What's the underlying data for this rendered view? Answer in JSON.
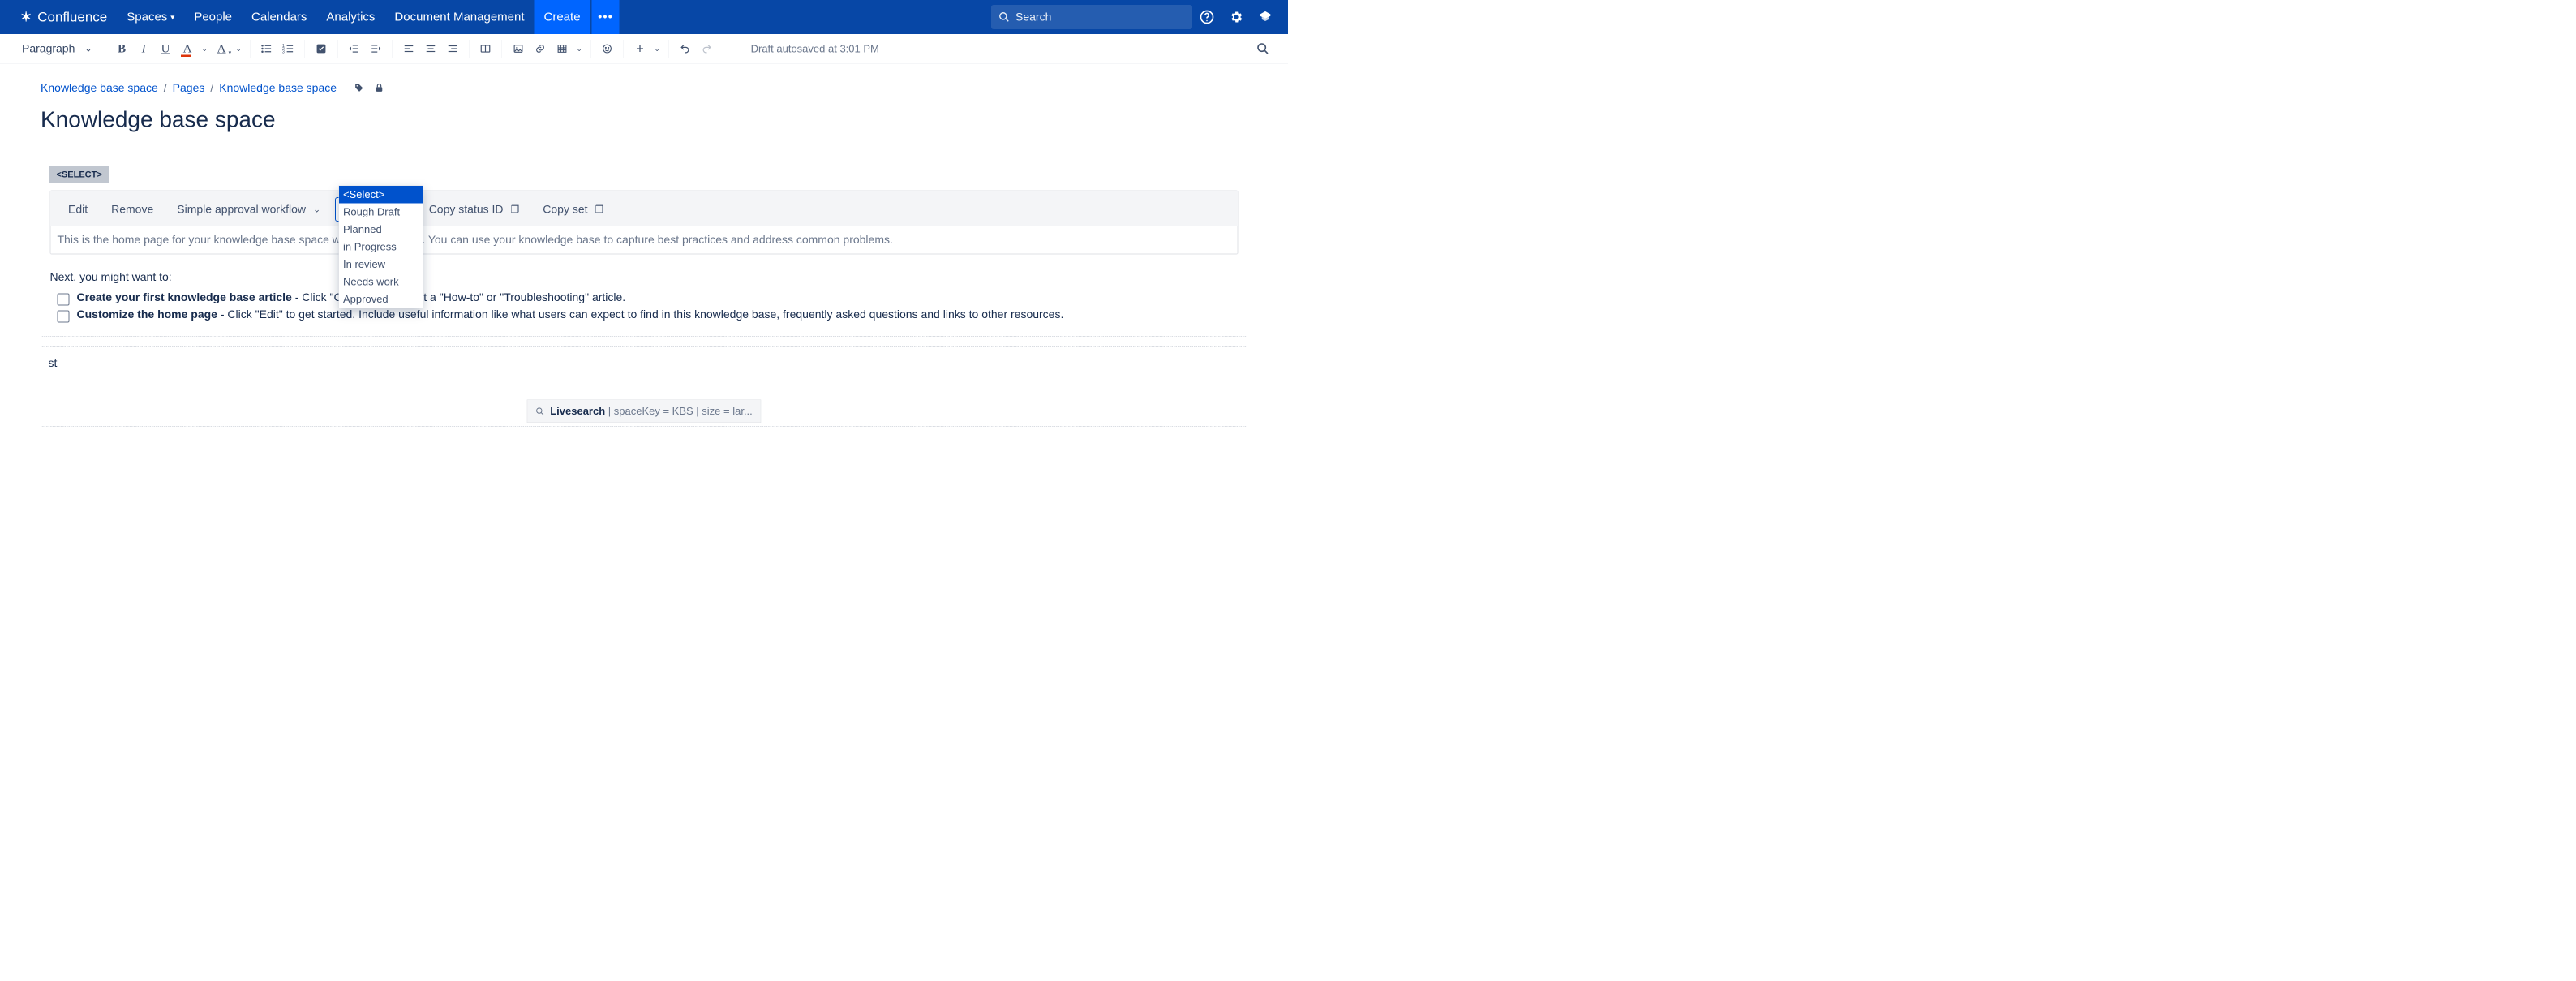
{
  "nav": {
    "brand": "Confluence",
    "items": [
      "Spaces",
      "People",
      "Calendars",
      "Analytics",
      "Document Management"
    ],
    "create": "Create",
    "search_placeholder": "Search"
  },
  "toolbar": {
    "para": "Paragraph",
    "draft": "Draft autosaved at 3:01 PM"
  },
  "crumbs": {
    "a": "Knowledge base space",
    "b": "Pages",
    "c": "Knowledge base space"
  },
  "title": "Knowledge base space",
  "macro": {
    "tag": "<SELECT>",
    "edit": "Edit",
    "remove": "Remove",
    "workflow": "Simple approval workflow",
    "select": "<Select>",
    "copy_status": "Copy status ID",
    "copy_set": "Copy set",
    "body": "This is the home page for your knowledge base space within Confluence. You can use your knowledge base to capture best practices and address common problems.",
    "options": [
      "<Select>",
      "Rough Draft",
      "Planned",
      "in Progress",
      "In review",
      "Needs work",
      "Approved"
    ]
  },
  "next": "Next, you might want to:",
  "tasks": [
    {
      "b": "Create your first knowledge base article",
      "t": " - Click \"Create\" and select a \"How-to\" or \"Troubleshooting\" article."
    },
    {
      "b": "Customize the home page",
      "t": " - Click \"Edit\" to get started. Include useful information like what users can expect to find in this knowledge base, frequently asked questions and links to other resources."
    }
  ],
  "macro2": {
    "st": "st",
    "live_b": "Livesearch",
    "live_t": " | spaceKey = KBS | size = lar..."
  }
}
